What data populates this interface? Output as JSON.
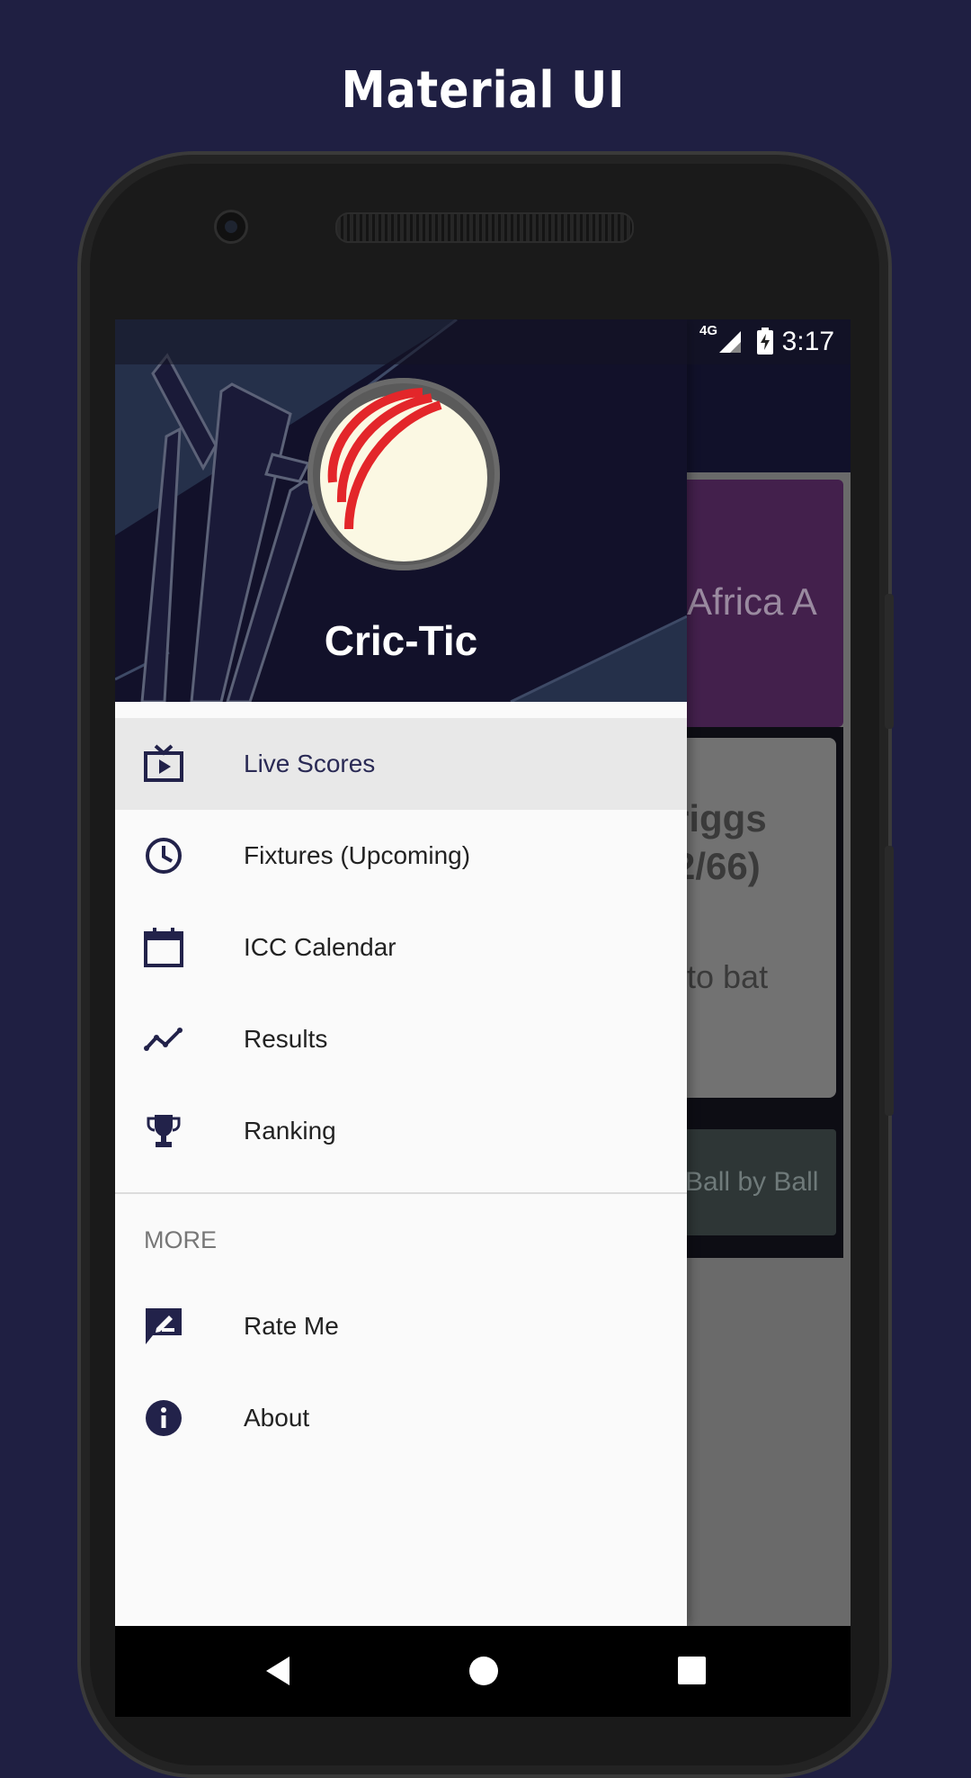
{
  "promo": {
    "title": "Material UI"
  },
  "status_bar": {
    "network": "4G",
    "time": "3:17"
  },
  "background_app": {
    "card_title": "Africa A",
    "player_line1": "riggs",
    "player_line2": "2/66)",
    "status_text": "to bat",
    "ball_button": "Ball by Ball",
    "card_color": "#43204c"
  },
  "drawer": {
    "app_name": "Cric-Tic",
    "items": [
      {
        "label": "Live Scores",
        "icon": "live-tv-icon",
        "active": true
      },
      {
        "label": "Fixtures (Upcoming)",
        "icon": "clock-icon"
      },
      {
        "label": "ICC Calendar",
        "icon": "calendar-icon"
      },
      {
        "label": "Results",
        "icon": "trending-icon"
      },
      {
        "label": "Ranking",
        "icon": "trophy-icon"
      }
    ],
    "section_label": "MORE",
    "more_items": [
      {
        "label": "Rate Me",
        "icon": "rate-review-icon"
      },
      {
        "label": "About",
        "icon": "info-icon"
      }
    ]
  },
  "nav_bar": {
    "back": "back-icon",
    "home": "home-icon",
    "recents": "recents-icon"
  },
  "colors": {
    "accent": "#1f1f42",
    "header": "#12112a",
    "ball_red": "#e3262a",
    "ball_cream": "#fbf8e3"
  }
}
